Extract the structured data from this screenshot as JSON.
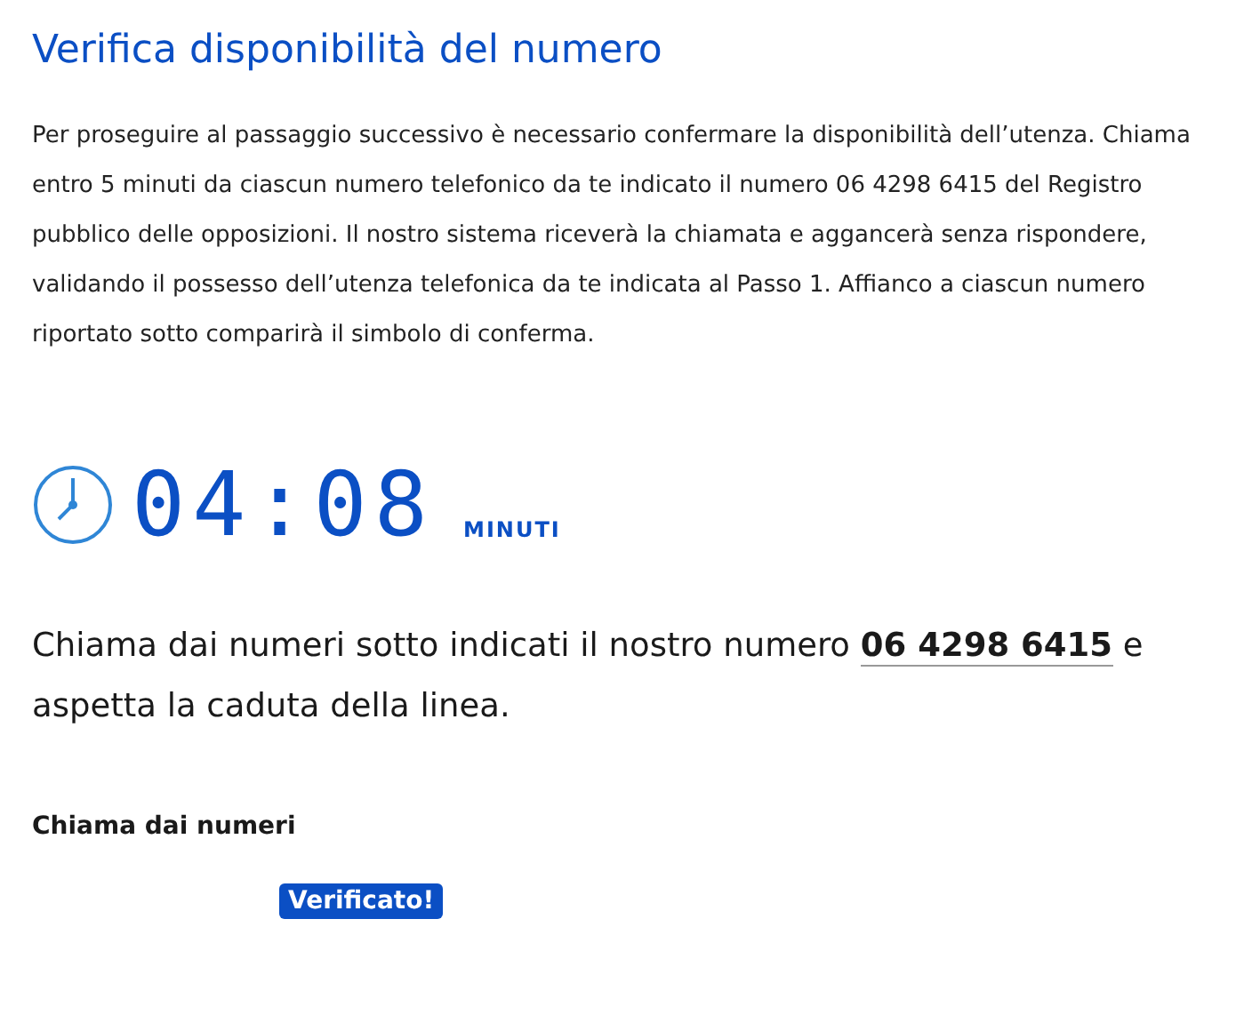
{
  "title": "Verifica disponibilità del numero",
  "intro": "Per proseguire al passaggio successivo è necessario confermare la disponibilità dell’utenza. Chiama entro 5 minuti da ciascun numero telefonico da te indicato il numero 06 4298 6415 del Registro pubblico delle opposizioni. Il nostro sistema riceverà la chiamata e aggancerà senza rispondere, validando il possesso dell’utenza telefonica da te indicata al Passo 1. Affianco a ciascun numero riportato sotto comparirà il simbolo di conferma.",
  "timer": {
    "time": "04:08",
    "unit": "MINUTI"
  },
  "instruction": {
    "before": "Chiama dai numeri sotto indicati il nostro numero",
    "link": "06 4298 6415",
    "after": "e aspetta la caduta della linea."
  },
  "numbers_heading": "Chiama dai numeri",
  "numbers": [
    {
      "status": "Verificato!",
      "verified": true
    }
  ]
}
